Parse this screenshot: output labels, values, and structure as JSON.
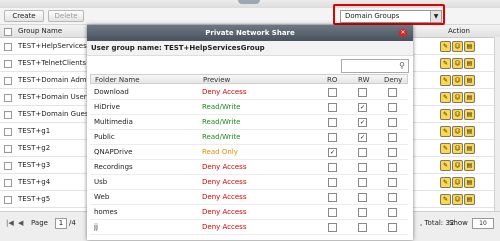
{
  "toolbar": {
    "create_label": "Create",
    "delete_label": "Delete",
    "group_select_value": "Domain Groups"
  },
  "list": {
    "header_group_name": "Group Name",
    "header_action": "Action",
    "rows": [
      "TEST+HelpServicesGrou",
      "TEST+TelnetClients",
      "TEST+Domain Admins",
      "TEST+Domain Users",
      "TEST+Domain Guests",
      "TEST+g1",
      "TEST+g2",
      "TEST+g3",
      "TEST+g4",
      "TEST+g5"
    ]
  },
  "footer": {
    "page_label": "Page",
    "page_value": "1",
    "page_total": "/4",
    "total_text": ", Total: 32",
    "show_label": "Show",
    "show_value": "10"
  },
  "dialog": {
    "title": "Private Network Share",
    "user_group_label": "User group name: TEST+HelpServicesGroup",
    "columns": {
      "folder": "Folder Name",
      "preview": "Preview",
      "ro": "RO",
      "rw": "RW",
      "deny": "Deny"
    },
    "rows": [
      {
        "folder": "Download",
        "preview": "Deny Access",
        "ro": false,
        "rw": false,
        "deny": false
      },
      {
        "folder": "HiDrive",
        "preview": "Read/Write",
        "ro": false,
        "rw": true,
        "deny": false
      },
      {
        "folder": "Multimedia",
        "preview": "Read/Write",
        "ro": false,
        "rw": true,
        "deny": false
      },
      {
        "folder": "Public",
        "preview": "Read/Write",
        "ro": false,
        "rw": true,
        "deny": false
      },
      {
        "folder": "QNAPDrive",
        "preview": "Read Only",
        "ro": true,
        "rw": false,
        "deny": false
      },
      {
        "folder": "Recordings",
        "preview": "Deny Access",
        "ro": false,
        "rw": false,
        "deny": false
      },
      {
        "folder": "Usb",
        "preview": "Deny Access",
        "ro": false,
        "rw": false,
        "deny": false
      },
      {
        "folder": "Web",
        "preview": "Deny Access",
        "ro": false,
        "rw": false,
        "deny": false
      },
      {
        "folder": "homes",
        "preview": "Deny Access",
        "ro": false,
        "rw": false,
        "deny": false
      },
      {
        "folder": "jj",
        "preview": "Deny Access",
        "ro": false,
        "rw": false,
        "deny": false
      }
    ]
  },
  "colors": {
    "deny": "#d10000",
    "read_write": "#1d8a1d",
    "read_only": "#e68a00",
    "highlight_box": "#e00000"
  },
  "icons": {
    "close": "close-icon",
    "search": "search-icon",
    "row_actions": [
      "edit-icon",
      "users-icon",
      "folder-permission-icon"
    ]
  }
}
